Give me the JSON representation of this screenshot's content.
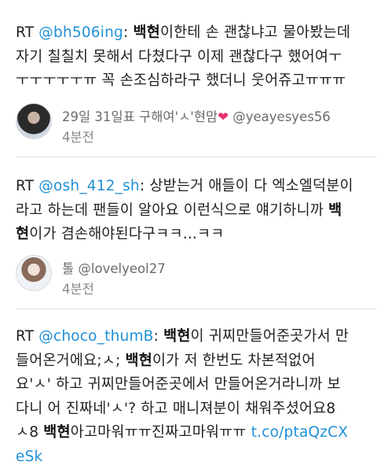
{
  "tweets": [
    {
      "prefix": "RT ",
      "mention": "@bh506ing",
      "lines": [
        [
          ": ",
          {
            "hl": "백현"
          },
          "이한테 손 괜찮냐고 물아봤는데"
        ],
        [
          "자기 칠칠치 못해서 다쳤다구 이제 괜찮다구 했어여ㅜ"
        ],
        [
          "ㅜㅜㅜㅜㅜㅠ 꼭 손조심하라구 했더니 웃어쥬고ㅠㅠㅠ"
        ]
      ],
      "author": {
        "text": "29일 31일표 구해여'ㅅ'현맘",
        "heart": "❤",
        "handle": " @yeayesyes56"
      },
      "time": "4분전"
    },
    {
      "prefix": "RT ",
      "mention": "@osh_412_sh",
      "lines": [
        [
          ": 상받는거 애들이 다 엑소엘덕분이"
        ],
        [
          "라고 하는데 팬들이 알아요 이런식으로 얘기하니까 ",
          {
            "hl": "백"
          }
        ],
        [
          {
            "hl": "현"
          },
          "이가 겸손해야된다구ㅋㅋ...ㅋㅋ"
        ]
      ],
      "author": {
        "text": "톨 @lovelyeol27",
        "heart": "",
        "handle": ""
      },
      "time": "4분전"
    },
    {
      "prefix": "RT ",
      "mention": "@choco_thumB",
      "lines": [
        [
          ": ",
          {
            "hl": "백현"
          },
          "이 귀찌만들어준곳가서 만"
        ],
        [
          "들어온거에요;ㅅ; ",
          {
            "hl": "백현"
          },
          "이가 저 한번도 차본적없어"
        ],
        [
          "요'ㅅ' 하고 귀찌만들어준곳에서 만들어온거라니까 보"
        ],
        [
          "다니 어 진짜네'ㅅ'? 하고 매니져분이 채워주셨어요8"
        ],
        [
          "ㅅ8 ",
          {
            "hl": "백현"
          },
          "아고마워ㅠㅠ진짜고마워ㅠㅠ ",
          {
            "link": "t.co/ptaQzCX"
          }
        ],
        [
          {
            "link": "eSk"
          }
        ]
      ],
      "author": null,
      "time": ""
    }
  ]
}
